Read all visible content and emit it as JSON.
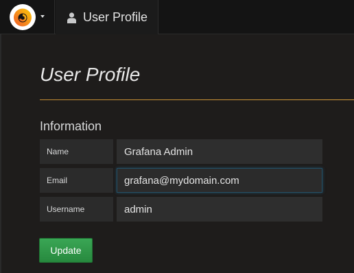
{
  "navbar": {
    "logo_icon": "grafana-logo-icon",
    "menu_caret_icon": "caret-down-icon",
    "breadcrumb_icon": "user-icon",
    "breadcrumb_label": "User Profile"
  },
  "page": {
    "title": "User Profile",
    "section_title": "Information",
    "fields": [
      {
        "label": "Name",
        "value": "Grafana Admin"
      },
      {
        "label": "Email",
        "value": "grafana@mydomain.com",
        "focused": true
      },
      {
        "label": "Username",
        "value": "admin"
      }
    ],
    "update_label": "Update"
  },
  "colors": {
    "background": "#1e1c1b",
    "navbar": "#141414",
    "accent_rule": "#c28b33",
    "button_green": "#2f9a48",
    "input_focus_border": "#244f65"
  }
}
